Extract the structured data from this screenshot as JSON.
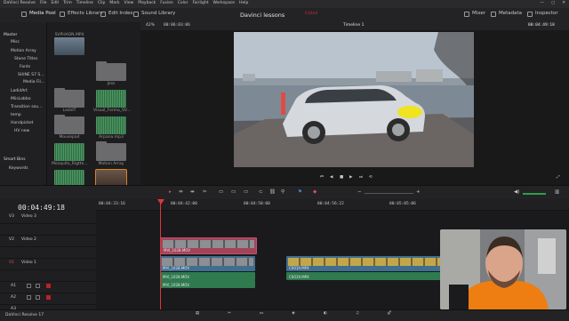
{
  "app": {
    "window_title": "DaVinci Resolve - Davinci lessons",
    "version_label": "DaVinci Resolve 17"
  },
  "menu": [
    "DaVinci Resolve",
    "File",
    "Edit",
    "Trim",
    "Timeline",
    "Clip",
    "Mark",
    "View",
    "Playback",
    "Fusion",
    "Color",
    "Fairlight",
    "Workspace",
    "Help"
  ],
  "toolbar": {
    "left": [
      "Media Pool",
      "Effects Library",
      "Edit Index",
      "Sound Library"
    ],
    "project_title": "Davinci lessons",
    "edited": "Edited",
    "right": [
      "Mixer",
      "Metadata",
      "Inspector"
    ]
  },
  "sidebar": {
    "master": "Master",
    "items": [
      "Misc",
      "Motion Array",
      "Stone Titles",
      "Fonts",
      "SHINE S7 S...",
      "Media Fil...",
      "LadidArt",
      "MiisLabbo",
      "Transition sou...",
      "temp",
      "Handpicket",
      "HV new"
    ],
    "smart_bins": "Smart Bins",
    "keywords": "Keywords"
  },
  "media_pool": {
    "clips": [
      {
        "label": "SVPHAON.MP4",
        "kind": "video"
      },
      {
        "label": "Jess",
        "kind": "folder"
      },
      {
        "label": "LadidT",
        "kind": "folder"
      },
      {
        "label": "Visual_Forma_SV...",
        "kind": "audio"
      },
      {
        "label": "Mousepad",
        "kind": "folder"
      },
      {
        "label": "Arpana.mp3",
        "kind": "audio"
      },
      {
        "label": "Mosquito_Rigtte...",
        "kind": "audio"
      },
      {
        "label": "Motion Array",
        "kind": "folder"
      },
      {
        "label": "Movie.mp3",
        "kind": "audio"
      },
      {
        "label": "MVI_2839.MOV",
        "kind": "video"
      }
    ]
  },
  "viewer": {
    "zoom": "42%",
    "source_tc": "00:06:03:06",
    "timeline_name": "Timeline 1",
    "record_tc": "00:04:49:18"
  },
  "timeline": {
    "current_tc": "00:04:49:18",
    "ruler": [
      "00:04:33:16",
      "00:04:42:00",
      "00:04:50:00",
      "00:04:56:22",
      "00:05:05:06"
    ],
    "tracks": [
      {
        "id": "V3",
        "name": "Video 3",
        "kind": "video"
      },
      {
        "id": "V2",
        "name": "Video 2",
        "kind": "video"
      },
      {
        "id": "V1",
        "name": "Video 1",
        "kind": "video"
      },
      {
        "id": "A1",
        "name": "",
        "kind": "audio"
      },
      {
        "id": "A2",
        "name": "",
        "kind": "audio"
      },
      {
        "id": "A3",
        "name": "",
        "kind": "audio"
      },
      {
        "id": "A4",
        "name": "",
        "kind": "audio"
      }
    ],
    "clips": [
      {
        "label": "MVI_1028.MOV",
        "track": "V2",
        "color": "#a3435a"
      },
      {
        "label": "MVI_1028.MOV",
        "track": "V1",
        "color": "#3f6f8f"
      },
      {
        "label": "C0019.MP4",
        "track": "V1b",
        "color": "#3f6f8f"
      },
      {
        "label": "MVI_1028.MOV",
        "track": "A1",
        "color": "#2f7a4f"
      },
      {
        "label": "C0019.MP4",
        "track": "A1b",
        "color": "#2f7a4f"
      },
      {
        "label": "MVI_1028.MOV",
        "track": "A2",
        "color": "#2f7a4f"
      }
    ]
  },
  "pages": [
    "media",
    "cut",
    "edit",
    "fusion",
    "color",
    "fairlight",
    "deliver"
  ],
  "colors": {
    "accent": "#d98526",
    "playhead": "#e0353a",
    "video_clip": "#3f6f8f",
    "audio_clip": "#2f7a4f",
    "pink_clip": "#a3435a"
  }
}
